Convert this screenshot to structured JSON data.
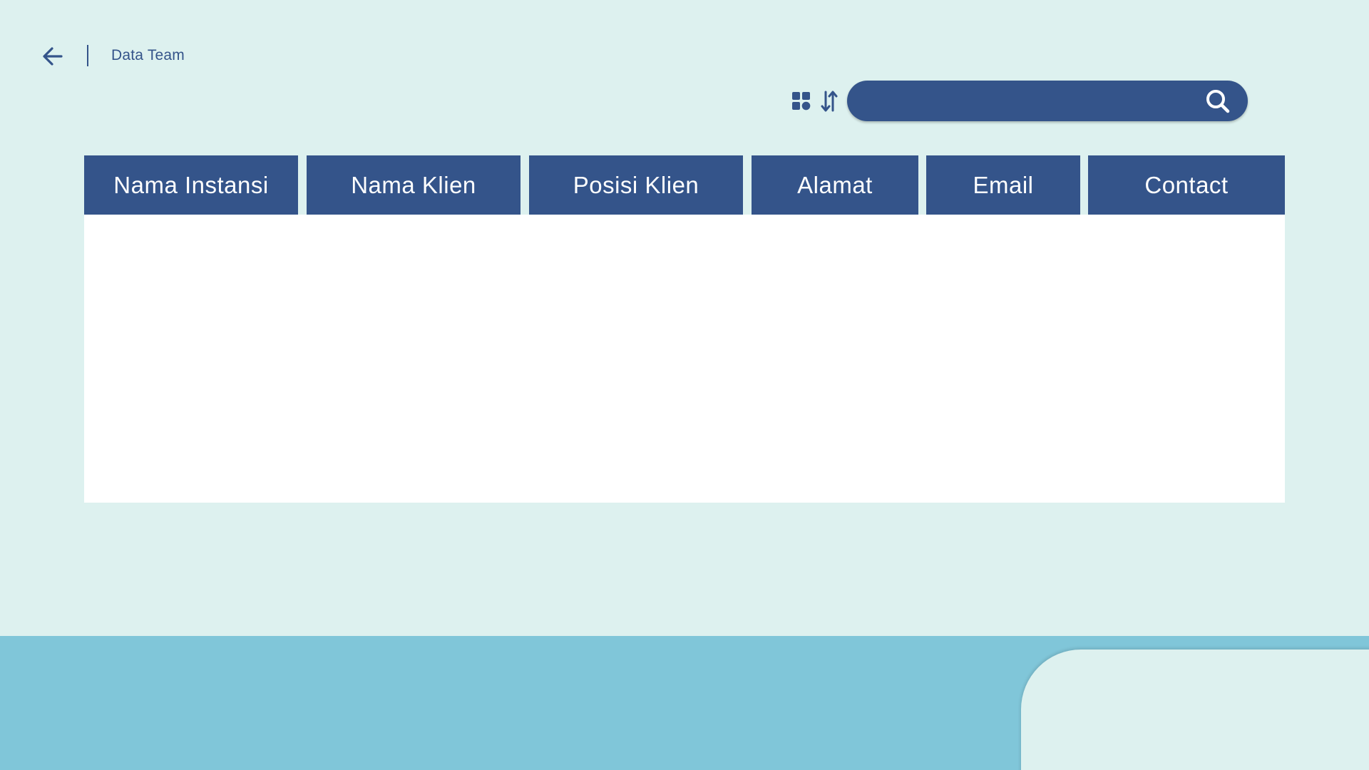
{
  "header": {
    "back_icon": "arrow-left-icon",
    "title": "Data Team"
  },
  "toolbar": {
    "view_icon": "grid-view-icon",
    "sort_icon": "sort-icon",
    "search": {
      "value": "",
      "placeholder": "",
      "icon": "search-icon"
    }
  },
  "table": {
    "columns": [
      {
        "label": "Nama Instansi"
      },
      {
        "label": "Nama Klien"
      },
      {
        "label": "Posisi Klien"
      },
      {
        "label": "Alamat"
      },
      {
        "label": "Email"
      },
      {
        "label": "Contact"
      }
    ],
    "rows": []
  },
  "colors": {
    "background": "#DDF1EF",
    "primary": "#34548A",
    "footer": "#80C6D9",
    "panel": "#FFFFFF"
  }
}
